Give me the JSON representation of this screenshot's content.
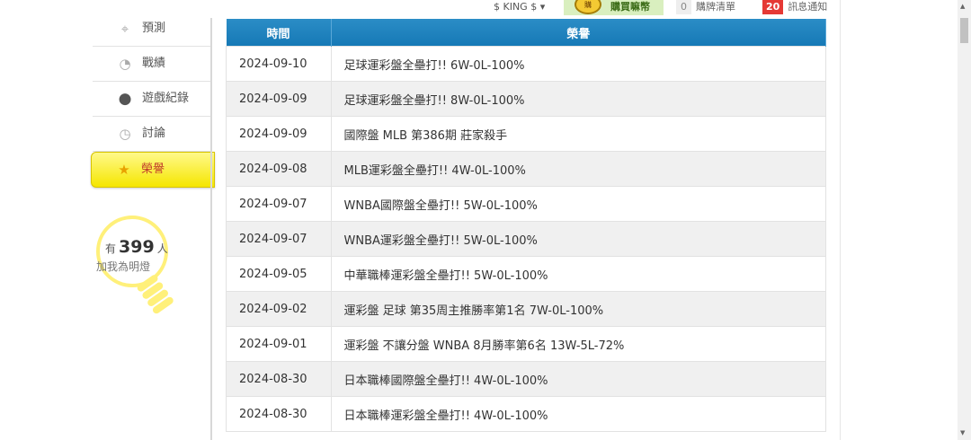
{
  "topbar": {
    "user": "$ KING $ ▾",
    "coin_text": "購",
    "buy_label": "購買嘛幣",
    "cart_count": "0",
    "cart_label": "購牌清單",
    "notice_count": "20",
    "notice_label": "訊息通知"
  },
  "sidebar": {
    "items": [
      {
        "label": "預測",
        "icon": "target-icon"
      },
      {
        "label": "戰績",
        "icon": "chart-icon"
      },
      {
        "label": "遊戲紀錄",
        "icon": "record-icon"
      },
      {
        "label": "討論",
        "icon": "chat-icon"
      },
      {
        "label": "榮譽",
        "icon": "trophy-icon"
      }
    ]
  },
  "bulb": {
    "prefix": "有",
    "count": "399",
    "suffix": "人",
    "caption": "加我為明燈"
  },
  "table": {
    "headers": {
      "date": "時間",
      "honor": "榮譽"
    },
    "rows": [
      {
        "date": "2024-09-10",
        "honor": "足球運彩盤全壘打!! 6W-0L-100%"
      },
      {
        "date": "2024-09-09",
        "honor": "足球運彩盤全壘打!! 8W-0L-100%"
      },
      {
        "date": "2024-09-09",
        "honor": "國際盤 MLB 第386期 莊家殺手"
      },
      {
        "date": "2024-09-08",
        "honor": "MLB運彩盤全壘打!! 4W-0L-100%"
      },
      {
        "date": "2024-09-07",
        "honor": "WNBA國際盤全壘打!! 5W-0L-100%"
      },
      {
        "date": "2024-09-07",
        "honor": "WNBA運彩盤全壘打!! 5W-0L-100%"
      },
      {
        "date": "2024-09-05",
        "honor": "中華職棒運彩盤全壘打!! 5W-0L-100%"
      },
      {
        "date": "2024-09-02",
        "honor": "運彩盤 足球 第35周主推勝率第1名 7W-0L-100%"
      },
      {
        "date": "2024-09-01",
        "honor": "運彩盤 不讓分盤 WNBA 8月勝率第6名 13W-5L-72%"
      },
      {
        "date": "2024-08-30",
        "honor": "日本職棒國際盤全壘打!! 4W-0L-100%"
      },
      {
        "date": "2024-08-30",
        "honor": "日本職棒運彩盤全壘打!! 4W-0L-100%"
      }
    ]
  },
  "colors": {
    "header_blue": "#1e85c2",
    "active_yellow": "#f7ea1c",
    "badge_red": "#e53935"
  }
}
